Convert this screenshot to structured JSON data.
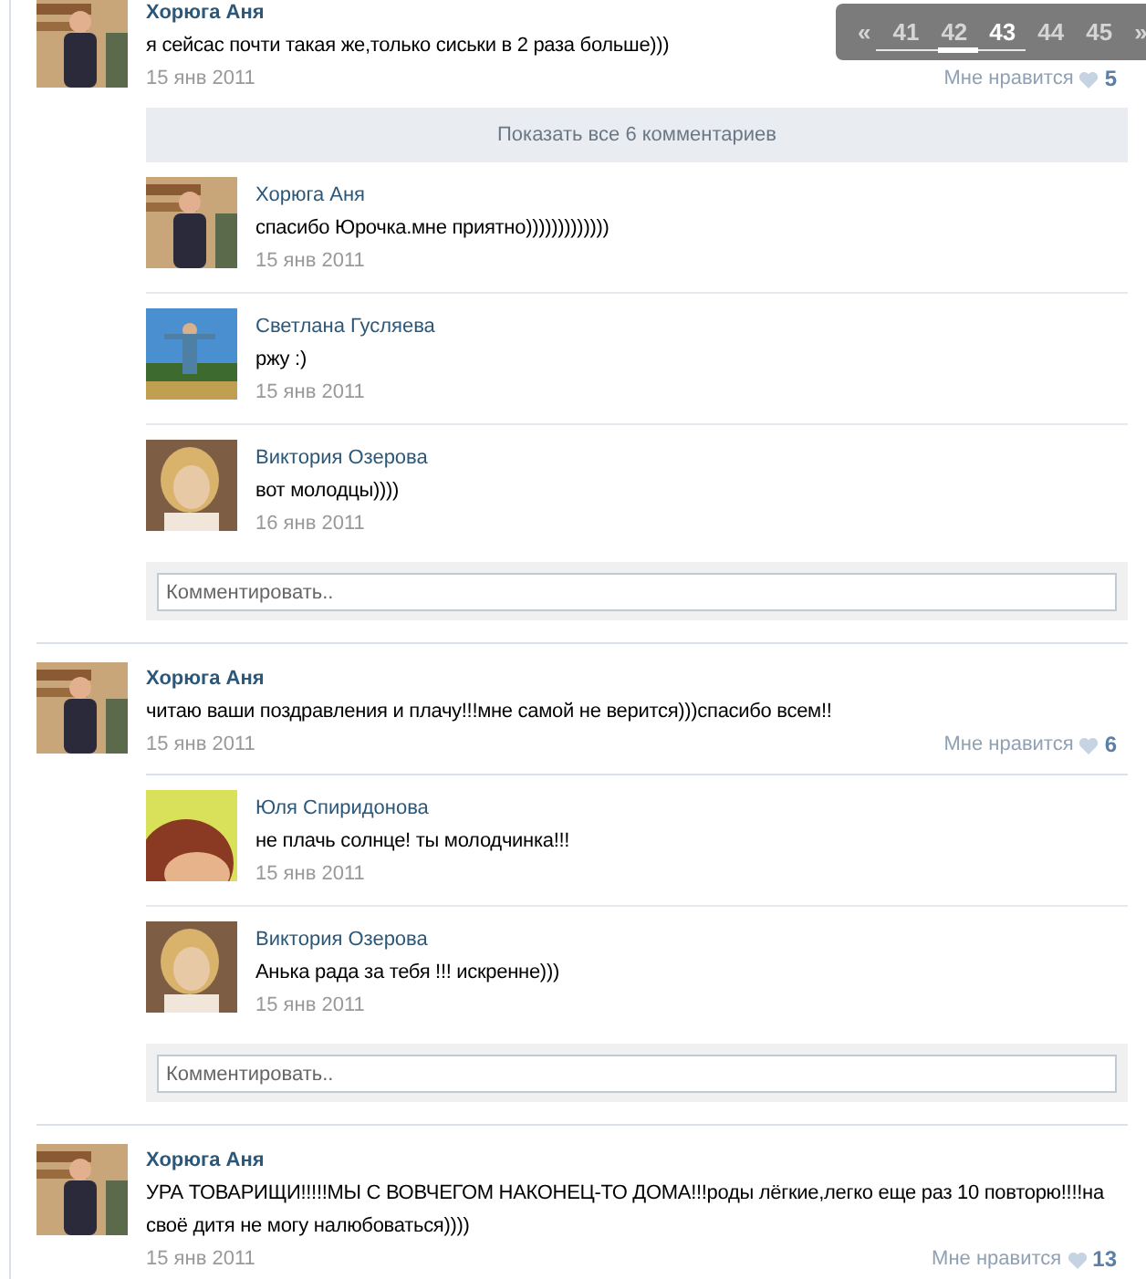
{
  "pager": {
    "prev": "«",
    "next": "»",
    "pages": [
      {
        "label": "41",
        "selected": false
      },
      {
        "label": "42",
        "selected": false
      },
      {
        "label": "43",
        "selected": true
      },
      {
        "label": "44",
        "selected": false
      },
      {
        "label": "45",
        "selected": false
      }
    ]
  },
  "posts": [
    {
      "author": "Хорюга Аня",
      "text": "я сейсас почти такая же,только сиськи в 2 раза больше)))",
      "date": "15 янв 2011",
      "like_label": "Мне нравится",
      "like_count": "5",
      "show_all": "Показать все 6 комментариев",
      "comments": [
        {
          "author": "Хорюга Аня",
          "text": "спасибо Юрочка.мне приятно)))))))))))))",
          "date": "15 янв 2011"
        },
        {
          "author": "Светлана Гусляева",
          "text": "ржу :)",
          "date": "15 янв 2011"
        },
        {
          "author": "Виктория Озерова",
          "text": "вот молодцы))))",
          "date": "16 янв 2011"
        }
      ],
      "comment_placeholder": "Комментировать.."
    },
    {
      "author": "Хорюга Аня",
      "text": "читаю ваши поздравления и плачу!!!мне самой не верится)))спасибо всем!!",
      "date": "15 янв 2011",
      "like_label": "Мне нравится",
      "like_count": "6",
      "comments": [
        {
          "author": "Юля Спиридонова",
          "text": "не плачь солнце! ты молодчинка!!!",
          "date": "15 янв 2011"
        },
        {
          "author": "Виктория Озерова",
          "text": "Анька рада за тебя !!! искренне)))",
          "date": "15 янв 2011"
        }
      ],
      "comment_placeholder": "Комментировать.."
    },
    {
      "author": "Хорюга Аня",
      "text": "УРА ТОВАРИЩИ!!!!!МЫ С ВОВЧЕГОМ НАКОНЕЦ-ТО ДОМА!!!роды лёгкие,легко еще раз 10 повторю!!!!на своё дитя не могу налюбоваться))))",
      "date": "15 янв 2011",
      "like_label": "Мне нравится",
      "like_count": "13"
    }
  ]
}
